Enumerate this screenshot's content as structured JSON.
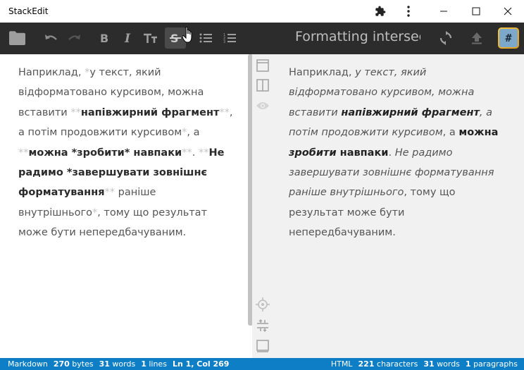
{
  "window": {
    "title": "StackEdit",
    "buttons": [
      "extensions-icon",
      "more-vert-icon",
      "minimize-icon",
      "maximize-icon",
      "close-icon"
    ]
  },
  "toolbar": {
    "tools": [
      "folder-icon",
      "undo-icon",
      "redo-icon",
      "bold-icon",
      "italic-icon",
      "heading-icon",
      "strikethrough-icon",
      "bullet-list-icon",
      "numbered-list-icon"
    ],
    "document_title": "Formatting intersecting",
    "right_tools": [
      "sync-icon",
      "publish-icon",
      "workspace-avatar"
    ],
    "avatar_glyph": "#"
  },
  "editor": {
    "segments": [
      {
        "t": "Наприклад, ",
        "s": "plain"
      },
      {
        "t": "*",
        "s": "md"
      },
      {
        "t": "у текст, який відформатовано курсивом, можна вставити ",
        "s": "plain"
      },
      {
        "t": "**",
        "s": "md"
      },
      {
        "t": "напівжирний фрагмент",
        "s": "bold"
      },
      {
        "t": "**",
        "s": "md"
      },
      {
        "t": ", а потім продовжити курсивом",
        "s": "plain"
      },
      {
        "t": "*",
        "s": "md"
      },
      {
        "t": ", а ",
        "s": "plain"
      },
      {
        "t": "**",
        "s": "md"
      },
      {
        "t": "можна *зробити* навпаки",
        "s": "bold"
      },
      {
        "t": "**",
        "s": "md"
      },
      {
        "t": ". ",
        "s": "plain"
      },
      {
        "t": "**",
        "s": "md"
      },
      {
        "t": "Не радимо *завершувати зовнішнє форматування",
        "s": "bold"
      },
      {
        "t": "**",
        "s": "md"
      },
      {
        "t": " раніше внутрішнього",
        "s": "plain"
      },
      {
        "t": "*",
        "s": "md"
      },
      {
        "t": ", тому що результат може бути непередбачуваним.",
        "s": "plain"
      }
    ]
  },
  "preview": {
    "segments": [
      {
        "t": "Наприклад, ",
        "s": "plain"
      },
      {
        "t": "у текст, який відформатовано курсивом, можна вставити ",
        "s": "italic"
      },
      {
        "t": "напівжирний фрагмент",
        "s": "bold-italic"
      },
      {
        "t": ", а потім продовжити курсивом",
        "s": "italic"
      },
      {
        "t": ", а ",
        "s": "plain"
      },
      {
        "t": "можна ",
        "s": "bold"
      },
      {
        "t": "зробити",
        "s": "bold-italic"
      },
      {
        "t": " навпаки",
        "s": "bold"
      },
      {
        "t": ". ",
        "s": "plain"
      },
      {
        "t": "Не радимо завершувати зовнішнє форматування раніше внутрішнього",
        "s": "italic"
      },
      {
        "t": ", тому що результат може бути непередбачуваним.",
        "s": "plain"
      }
    ]
  },
  "side_buttons": [
    "toggle-navigation-bar-icon",
    "toggle-side-preview-icon",
    "toggle-preview-icon",
    "scroll-sync-icon",
    "toggle-status-bar-icon",
    "toggle-statusbar-icon-bottom"
  ],
  "status": {
    "left": {
      "mode": "Markdown",
      "bytes": "270",
      "bytes_label": "bytes",
      "words": "31",
      "words_label": "words",
      "lines": "1",
      "lines_label": "lines",
      "position": "Ln 1, Col 269"
    },
    "right": {
      "mode": "HTML",
      "characters": "221",
      "characters_label": "characters",
      "words": "31",
      "words_label": "words",
      "paragraphs": "1",
      "paragraphs_label": "paragraphs"
    }
  },
  "colors": {
    "toolbar": "#2c2c2c",
    "statusbar": "#0e7fc6",
    "preview_bg": "#f1f1f1"
  }
}
